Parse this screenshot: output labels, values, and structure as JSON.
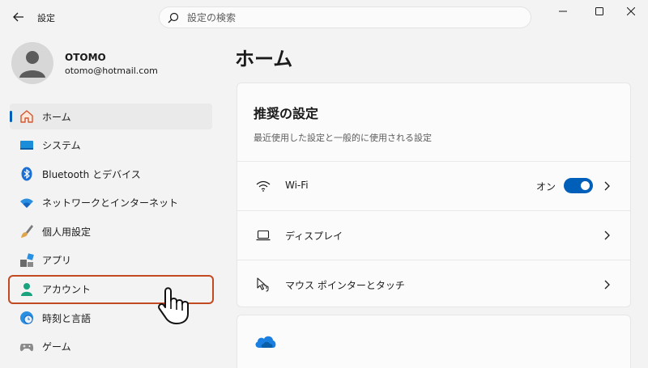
{
  "window": {
    "title": "設定"
  },
  "search": {
    "placeholder": "設定の検索"
  },
  "profile": {
    "name": "OTOMO",
    "email": "otomo@hotmail.com"
  },
  "sidebar": {
    "items": [
      {
        "label": "ホーム",
        "icon": "home-icon",
        "active": true
      },
      {
        "label": "システム",
        "icon": "system-icon"
      },
      {
        "label": "Bluetooth とデバイス",
        "icon": "bluetooth-icon"
      },
      {
        "label": "ネットワークとインターネット",
        "icon": "wifi-icon"
      },
      {
        "label": "個人用設定",
        "icon": "brush-icon"
      },
      {
        "label": "アプリ",
        "icon": "apps-icon"
      },
      {
        "label": "アカウント",
        "icon": "account-icon",
        "highlighted": true
      },
      {
        "label": "時刻と言語",
        "icon": "globe-clock-icon"
      },
      {
        "label": "ゲーム",
        "icon": "gamepad-icon"
      }
    ]
  },
  "main": {
    "title": "ホーム",
    "recommended": {
      "title": "推奨の設定",
      "subtitle": "最近使用した設定と一般的に使用される設定",
      "rows": [
        {
          "label": "Wi-Fi",
          "icon": "wifi-icon",
          "toggle_label": "オン",
          "toggle_on": true
        },
        {
          "label": "ディスプレイ",
          "icon": "laptop-icon"
        },
        {
          "label": "マウス ポインターとタッチ",
          "icon": "pointer-icon"
        }
      ]
    }
  },
  "colors": {
    "accent": "#005fb8",
    "highlight_border": "#c24a22",
    "background": "#f3f3f3",
    "card": "#fbfbfb"
  }
}
